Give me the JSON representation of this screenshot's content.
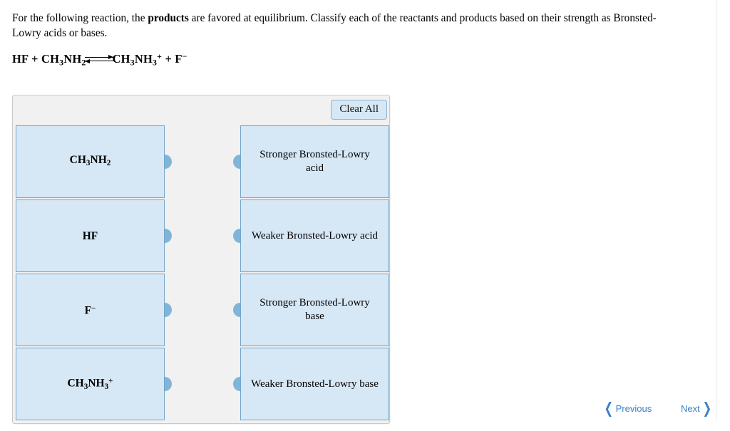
{
  "prompt": {
    "part1": "For the following reaction, the ",
    "emphasis": "products",
    "part2": " are favored at equilibrium. Classify each of the reactants and products based on their strength as Bronsted-Lowry acids or bases."
  },
  "equation": {
    "reactant1": "HF",
    "plus1": " + ",
    "reactant2_main": "CH",
    "reactant2_sub1": "3",
    "reactant2_mid": "NH",
    "reactant2_sub2": "2",
    "arrow": "equilibrium-double-arrow",
    "product1_main": "CH",
    "product1_sub1": "3",
    "product1_mid": "NH",
    "product1_sub2": "3",
    "product1_sup": "+",
    "plus2": " + ",
    "product2_main": "F",
    "product2_sup": "−"
  },
  "widget": {
    "clear_all_label": "Clear All",
    "left_cards": [
      {
        "id": "methylamine",
        "main": "CH",
        "sub1": "3",
        "mid": "NH",
        "sub2": "2",
        "sup": ""
      },
      {
        "id": "hydrogen-fluoride",
        "main": "HF",
        "sub1": "",
        "mid": "",
        "sub2": "",
        "sup": ""
      },
      {
        "id": "fluoride-ion",
        "main": "F",
        "sub1": "",
        "mid": "",
        "sub2": "",
        "sup": "−"
      },
      {
        "id": "methylammonium",
        "main": "CH",
        "sub1": "3",
        "mid": "NH",
        "sub2": "3",
        "sup": "+"
      }
    ],
    "right_cards": [
      {
        "id": "stronger-acid",
        "label": "Stronger Bronsted-Lowry acid"
      },
      {
        "id": "weaker-acid",
        "label": "Weaker Bronsted-Lowry acid"
      },
      {
        "id": "stronger-base",
        "label": "Stronger Bronsted-Lowry base"
      },
      {
        "id": "weaker-base",
        "label": "Weaker Bronsted-Lowry base"
      }
    ]
  },
  "nav": {
    "previous_label": "Previous",
    "next_label": "Next",
    "prev_chevron": "❮",
    "next_chevron": "❯"
  },
  "colors": {
    "card_fill": "#d6e7f5",
    "card_border": "#74a5c8",
    "nub": "#7fb5d8",
    "panel_bg": "#f1f1f1",
    "nav_blue": "#3a82c4"
  }
}
